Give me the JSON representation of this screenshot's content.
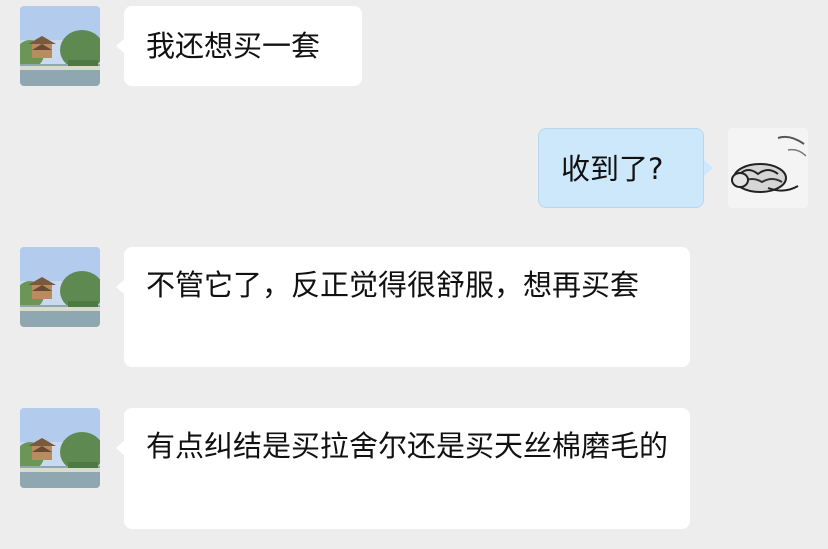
{
  "chat": {
    "messages": [
      {
        "side": "left",
        "avatar": "pavilion-garden-avatar",
        "text": "我还想买一套"
      },
      {
        "side": "right",
        "avatar": "sleeping-cat-sketch-avatar",
        "text": "收到了?"
      },
      {
        "side": "left",
        "avatar": "pavilion-garden-avatar",
        "text": "不管它了，反正觉得很舒服，想再买套"
      },
      {
        "side": "left",
        "avatar": "pavilion-garden-avatar",
        "text": "有点纠结是买拉舍尔还是买天丝棉磨毛的"
      }
    ]
  },
  "colors": {
    "background": "#ededed",
    "incoming_bubble": "#ffffff",
    "outgoing_bubble": "#cde7fb",
    "text": "#111111"
  }
}
